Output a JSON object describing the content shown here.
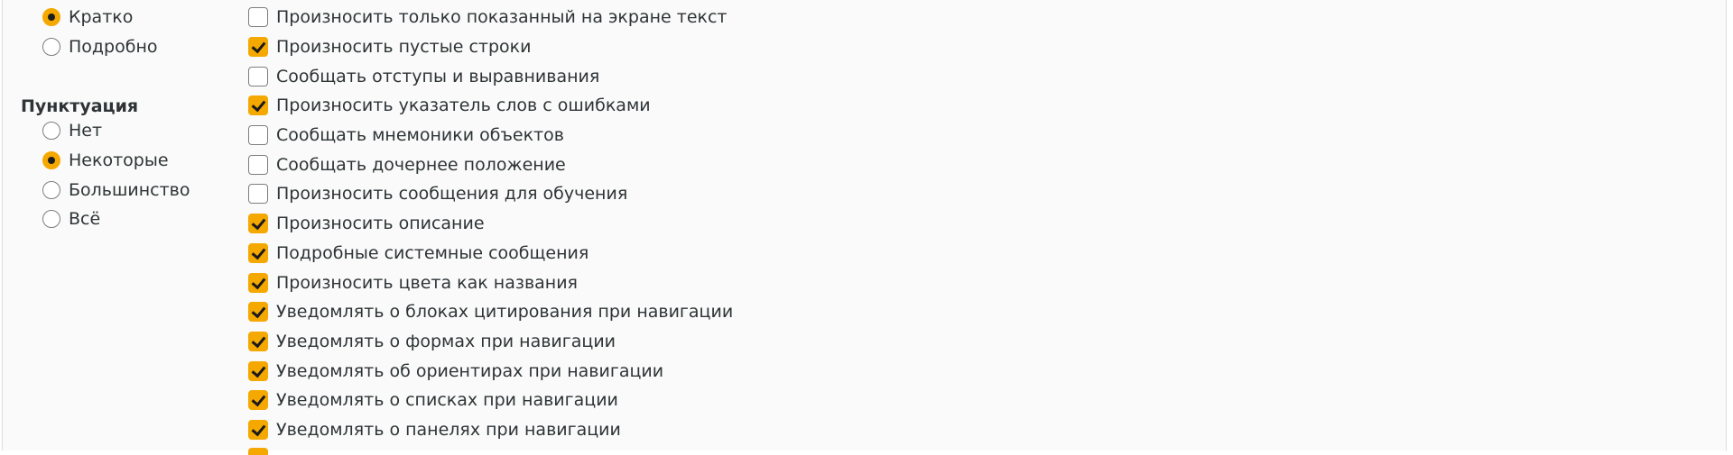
{
  "verbosity_options": [
    {
      "label": "Кратко",
      "selected": true
    },
    {
      "label": "Подробно",
      "selected": false
    }
  ],
  "punctuation": {
    "heading": "Пунктуация",
    "options": [
      {
        "label": "Нет",
        "selected": false
      },
      {
        "label": "Некоторые",
        "selected": true
      },
      {
        "label": "Большинство",
        "selected": false
      },
      {
        "label": "Всё",
        "selected": false
      }
    ]
  },
  "checkboxes": [
    {
      "label": "Произносить только показанный на экране текст",
      "checked": false
    },
    {
      "label": "Произносить пустые строки",
      "checked": true
    },
    {
      "label": "Сообщать отступы и выравнивания",
      "checked": false
    },
    {
      "label": "Произносить указатель слов с ошибками",
      "checked": true
    },
    {
      "label": "Сообщать мнемоники объектов",
      "checked": false
    },
    {
      "label": "Сообщать дочернее положение",
      "checked": false
    },
    {
      "label": "Произносить сообщения для обучения",
      "checked": false
    },
    {
      "label": "Произносить описание",
      "checked": true
    },
    {
      "label": "Подробные системные сообщения",
      "checked": true
    },
    {
      "label": "Произносить цвета как названия",
      "checked": true
    },
    {
      "label": "Уведомлять о блоках цитирования при навигации",
      "checked": true
    },
    {
      "label": "Уведомлять о формах при навигации",
      "checked": true
    },
    {
      "label": "Уведомлять об ориентирах при навигации",
      "checked": true
    },
    {
      "label": "Уведомлять о списках при навигации",
      "checked": true
    },
    {
      "label": "Уведомлять о панелях при навигации",
      "checked": true
    }
  ],
  "colors": {
    "accent": "#f5a800",
    "panel_bg": "#fafafa",
    "text": "#2e3436"
  }
}
